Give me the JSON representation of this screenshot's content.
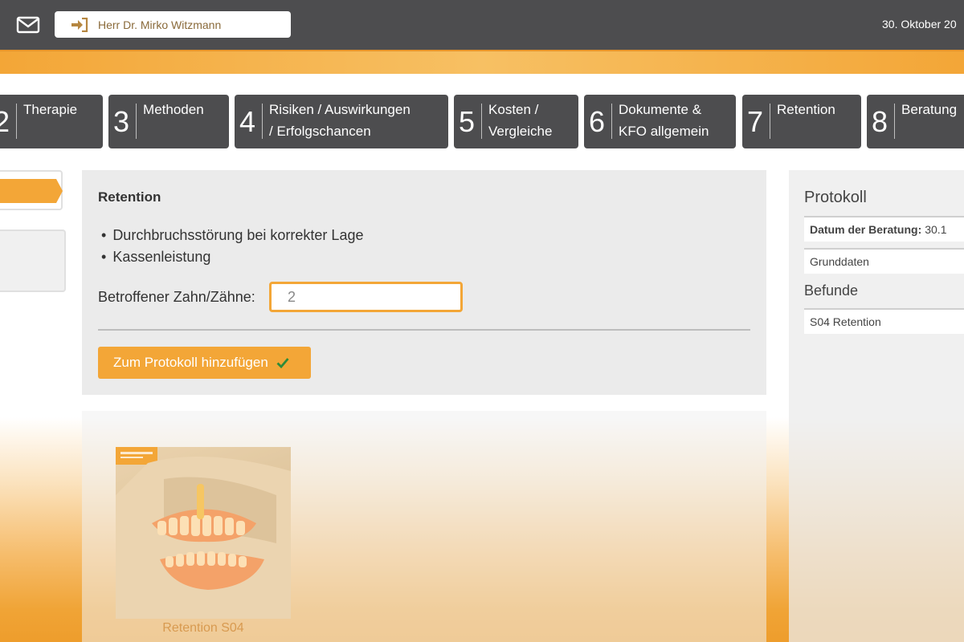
{
  "header": {
    "user_name": "Herr Dr. Mirko Witzmann",
    "date": "30. Oktober 20"
  },
  "steps": [
    {
      "number": "2",
      "label": "Therapie"
    },
    {
      "number": "3",
      "label": "Methoden"
    },
    {
      "number": "4",
      "label_line1": "Risiken / Auswirkungen",
      "label_line2": "/ Erfolgschancen"
    },
    {
      "number": "5",
      "label_line1": "Kosten /",
      "label_line2": "Vergleiche"
    },
    {
      "number": "6",
      "label_line1": "Dokumente &",
      "label_line2": "KFO allgemein"
    },
    {
      "number": "7",
      "label": "Retention"
    },
    {
      "number": "8",
      "label": "Beratung"
    }
  ],
  "main": {
    "title": "Retention",
    "bullets": [
      "Durchbruchsstörung bei korrekter Lage",
      "Kassenleistung"
    ],
    "tooth_label": "Betroffener Zahn/Zähne:",
    "tooth_value": "2",
    "add_button_label": "Zum Protokoll hinzufügen"
  },
  "image": {
    "caption": "Retention S04"
  },
  "protocol": {
    "title": "Protokoll",
    "date_label": "Datum der Beratung:",
    "date_value": "30.1",
    "grunddaten": "Grunddaten",
    "befunde_title": "Befunde",
    "befunde_item": "S04 Retention"
  },
  "colors": {
    "accent": "#f3a637",
    "dark": "#4d4d4f",
    "check": "#2e8b3a"
  }
}
